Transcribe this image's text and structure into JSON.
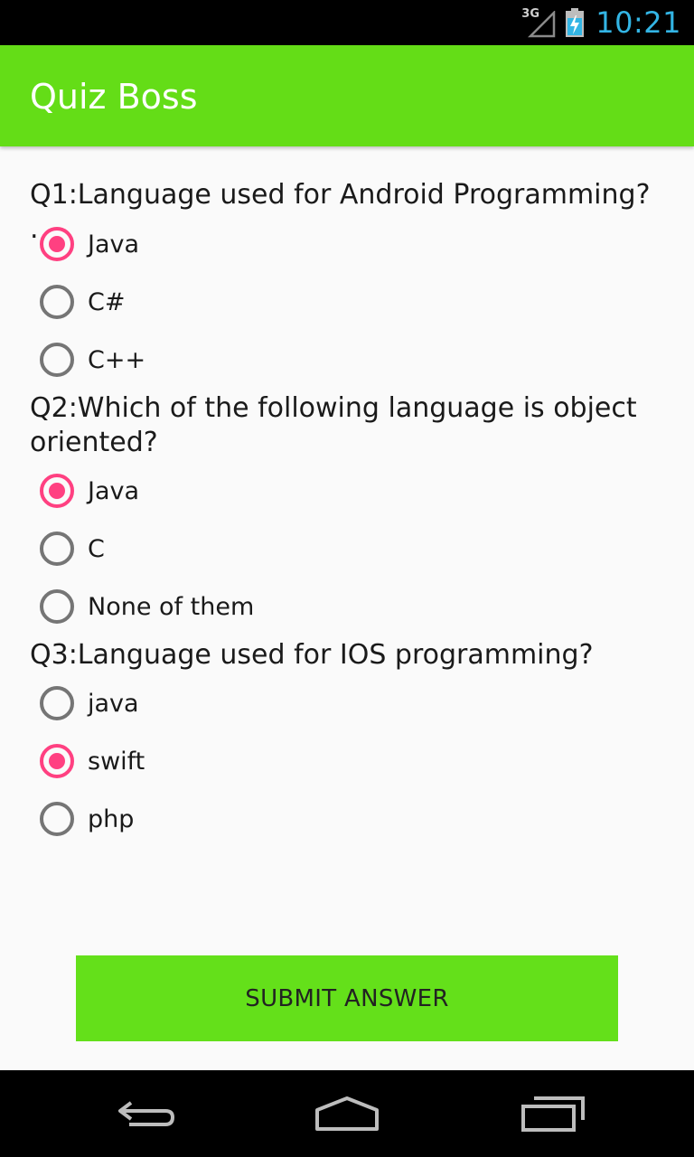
{
  "status_bar": {
    "network": "3G",
    "time": "10:21",
    "clock_color": "#33b5e5"
  },
  "app_bar": {
    "title": "Quiz Boss",
    "color": "#64dd17"
  },
  "questions": [
    {
      "text": "Q1:Language used for Android Programming? .",
      "options": [
        {
          "label": "Java",
          "checked": true
        },
        {
          "label": "C#",
          "checked": false
        },
        {
          "label": "C++",
          "checked": false
        }
      ]
    },
    {
      "text": "Q2:Which of the following language is object oriented?",
      "options": [
        {
          "label": "Java",
          "checked": true
        },
        {
          "label": "C",
          "checked": false
        },
        {
          "label": "None of them",
          "checked": false
        }
      ]
    },
    {
      "text": "Q3:Language used for IOS programming?",
      "options": [
        {
          "label": "java",
          "checked": false
        },
        {
          "label": "swift",
          "checked": true
        },
        {
          "label": "php",
          "checked": false
        }
      ]
    }
  ],
  "submit_label": "SUBMIT ANSWER",
  "accent_color": "#ff4081",
  "nav_bar": {
    "icons": [
      "back-icon",
      "home-icon",
      "recent-apps-icon"
    ]
  }
}
